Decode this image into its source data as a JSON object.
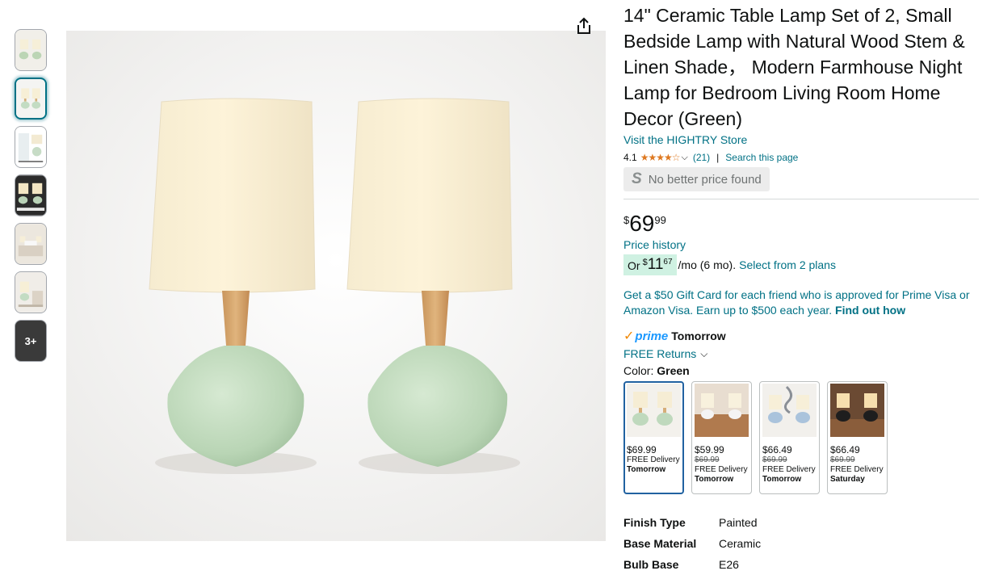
{
  "thumbnails": [
    {
      "name": "thumb-1",
      "active": false
    },
    {
      "name": "thumb-2",
      "active": true
    },
    {
      "name": "thumb-3",
      "active": false
    },
    {
      "name": "thumb-4",
      "active": false
    },
    {
      "name": "thumb-5",
      "active": false
    },
    {
      "name": "thumb-6",
      "active": false
    }
  ],
  "more_thumbs_label": "3+",
  "product": {
    "title": "14\" Ceramic Table Lamp Set of 2, Small Bedside Lamp with Natural Wood Stem & Linen Shade， Modern Farmhouse Night Lamp for Bedroom Living Room Home Decor (Green)",
    "store_link": "Visit the HIGHTRY Store",
    "rating": "4.1",
    "stars": "★★★★☆",
    "rating_count": "(21)",
    "separator": "|",
    "search_link": "Search this page",
    "no_better_price": "No better price found",
    "no_better_logo": "S"
  },
  "price": {
    "symbol": "$",
    "whole": "69",
    "fraction": "99",
    "history_link": "Price history"
  },
  "monthly": {
    "or": "Or",
    "symbol": "$",
    "whole": "11",
    "fraction": "67",
    "suffix": "/mo (6 mo).",
    "plans_link": "Select from 2 plans"
  },
  "promo": {
    "text": "Get a $50 Gift Card for each friend who is approved for Prime Visa or Amazon Visa. Earn up to $500 each year.",
    "link": "Find out how"
  },
  "delivery": {
    "prime_check": "✓",
    "prime_word": "prime",
    "day": "Tomorrow",
    "returns": "FREE Returns",
    "returns_chevron": "⌵"
  },
  "color": {
    "label": "Color:",
    "value": "Green"
  },
  "swatches": [
    {
      "price": "$69.99",
      "strike": "",
      "delivery": "FREE Delivery",
      "day": "Tomorrow",
      "selected": true
    },
    {
      "price": "$59.99",
      "strike": "$69.99",
      "delivery": "FREE Delivery",
      "day": "Tomorrow",
      "selected": false
    },
    {
      "price": "$66.49",
      "strike": "$69.99",
      "delivery": "FREE Delivery",
      "day": "Tomorrow",
      "selected": false
    },
    {
      "price": "$66.49",
      "strike": "$69.99",
      "delivery": "FREE Delivery",
      "day": "Saturday",
      "selected": false
    }
  ],
  "specs": [
    {
      "key": "Finish Type",
      "value": "Painted"
    },
    {
      "key": "Base Material",
      "value": "Ceramic"
    },
    {
      "key": "Bulb Base",
      "value": "E26"
    }
  ],
  "colors": {
    "link": "#007185",
    "star": "#de7921",
    "prime_blue": "#1a98ff",
    "monthly_bg": "#cff1e2",
    "selected_border": "#2162a1"
  }
}
